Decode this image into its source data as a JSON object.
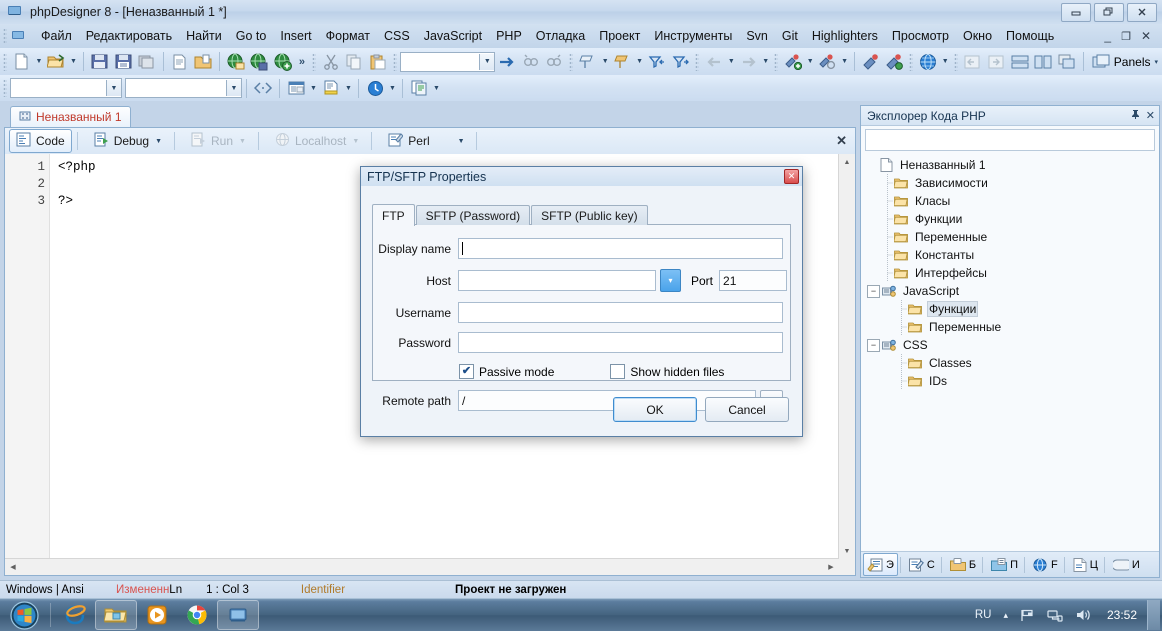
{
  "window": {
    "title": "phpDesigner 8 - [Неназванный 1 *]",
    "icon": "app-icon",
    "minimize": "–",
    "maximize": "❐",
    "close": "✕"
  },
  "menubar": {
    "items": [
      {
        "label": "Файл"
      },
      {
        "label": "Редактировать"
      },
      {
        "label": "Найти"
      },
      {
        "label": "Go to"
      },
      {
        "label": "Insert"
      },
      {
        "label": "Формат"
      },
      {
        "label": "CSS"
      },
      {
        "label": "JavaScript"
      },
      {
        "label": "PHP"
      },
      {
        "label": "Отладка"
      },
      {
        "label": "Проект"
      },
      {
        "label": "Инструменты"
      },
      {
        "label": "Svn"
      },
      {
        "label": "Git"
      },
      {
        "label": "Highlighters"
      },
      {
        "label": "Просмотр"
      },
      {
        "label": "Окно"
      },
      {
        "label": "Помощь"
      }
    ],
    "mdi_minimize": "_",
    "mdi_restore": "❐",
    "mdi_close": "✕"
  },
  "toolbar1": {
    "overflow_label": "»",
    "search_combo_value": "",
    "panels_label": "Panels",
    "panels_arrow": "▾"
  },
  "toolbar2": {
    "combo1_value": "",
    "combo2_value": ""
  },
  "editor": {
    "tab_label": "Неназванный 1",
    "buttons": [
      {
        "label": "Code",
        "state": "active",
        "has_arrow": false
      },
      {
        "label": "Debug",
        "state": "enabled",
        "has_arrow": true
      },
      {
        "label": "Run",
        "state": "disabled",
        "has_arrow": true
      },
      {
        "label": "Localhost",
        "state": "disabled",
        "has_arrow": true
      },
      {
        "label": "Perl",
        "state": "enabled",
        "has_arrow": true
      }
    ],
    "close_label": "✕",
    "code_lines": [
      {
        "num": "1",
        "text": "<?php"
      },
      {
        "num": "2",
        "text": ""
      },
      {
        "num": "3",
        "text": "?>"
      }
    ]
  },
  "right_panel": {
    "title": "Эксплорер Кода PHP",
    "pin_icon": "pin-icon",
    "close_icon": "✕",
    "search_value": "",
    "tree": [
      {
        "label": "Неназванный 1",
        "depth": 0,
        "icon": "file-icon",
        "expander": "",
        "selected": false
      },
      {
        "label": "Зависимости",
        "depth": 1,
        "icon": "folder-icon",
        "expander": "",
        "selected": false
      },
      {
        "label": "Класы",
        "depth": 1,
        "icon": "folder-icon",
        "expander": "",
        "selected": false
      },
      {
        "label": "Функции",
        "depth": 1,
        "icon": "folder-icon",
        "expander": "",
        "selected": false
      },
      {
        "label": "Переменные",
        "depth": 1,
        "icon": "folder-icon",
        "expander": "",
        "selected": false
      },
      {
        "label": "Константы",
        "depth": 1,
        "icon": "folder-icon",
        "expander": "",
        "selected": false
      },
      {
        "label": "Интерфейсы",
        "depth": 1,
        "icon": "folder-icon",
        "expander": "",
        "selected": false
      },
      {
        "label": "JavaScript",
        "depth": 0,
        "icon": "script-icon",
        "expander": "−",
        "selected": false
      },
      {
        "label": "Функции",
        "depth": 2,
        "icon": "folder-icon",
        "expander": "",
        "selected": true
      },
      {
        "label": "Переменные",
        "depth": 2,
        "icon": "folder-icon",
        "expander": "",
        "selected": false
      },
      {
        "label": "CSS",
        "depth": 0,
        "icon": "script-icon",
        "expander": "−",
        "selected": false
      },
      {
        "label": "Classes",
        "depth": 2,
        "icon": "folder-icon",
        "expander": "",
        "selected": false
      },
      {
        "label": "IDs",
        "depth": 2,
        "icon": "folder-icon",
        "expander": "",
        "selected": false
      }
    ],
    "tabs": [
      {
        "label": "Э",
        "icon": "explorer-icon",
        "active": true
      },
      {
        "label": "С",
        "icon": "snippets-icon",
        "active": false
      },
      {
        "label": "Б",
        "icon": "library-icon",
        "active": false
      },
      {
        "label": "П",
        "icon": "projects-icon",
        "active": false
      },
      {
        "label": "F",
        "icon": "ftp-icon",
        "active": false
      },
      {
        "label": "Ц",
        "icon": "todo-icon",
        "active": false
      },
      {
        "label": "И",
        "icon": "messages-icon",
        "active": false
      }
    ]
  },
  "statusbar": {
    "encoding": "Windows | Ansi",
    "modified": "Измененн",
    "ln_label": "Ln",
    "position": "1 : Col   3",
    "token": "Identifier",
    "project": "Проект не загружен"
  },
  "dialog": {
    "title": "FTP/SFTP Properties",
    "close_label": "✕",
    "tabs": [
      {
        "label": "FTP",
        "active": true
      },
      {
        "label": "SFTP (Password)",
        "active": false
      },
      {
        "label": "SFTP (Public key)",
        "active": false
      }
    ],
    "fields": {
      "display_name_label": "Display name",
      "display_name_value": "",
      "host_label": "Host",
      "host_value": "",
      "host_dropdown_arrow": "▾",
      "port_label": "Port",
      "port_value": "21",
      "username_label": "Username",
      "username_value": "",
      "password_label": "Password",
      "password_value": "",
      "remote_path_label": "Remote path",
      "remote_path_value": "/",
      "browse_label": "..."
    },
    "checkboxes": [
      {
        "label": "Passive mode",
        "checked": true,
        "mark": "✔"
      },
      {
        "label": "Show hidden files",
        "checked": false,
        "mark": ""
      }
    ],
    "ok_label": "OK",
    "cancel_label": "Cancel"
  },
  "taskbar": {
    "start_icon": "windows-start-icon",
    "items": [
      {
        "icon": "internet-explorer-icon",
        "open": false
      },
      {
        "icon": "file-explorer-icon",
        "open": true
      },
      {
        "icon": "media-player-icon",
        "open": false
      },
      {
        "icon": "chrome-icon",
        "open": false
      },
      {
        "icon": "phpdesigner-icon",
        "open": true
      }
    ],
    "language": "RU",
    "tray_expand": "▴",
    "tray_icons": [
      "flag-icon",
      "network-icon",
      "volume-icon"
    ],
    "clock": "23:52"
  },
  "colors": {
    "accent": "#4aa3ea",
    "title_text": "#15324f",
    "tab_text_red": "#c0392b",
    "status_modified": "#d9534f",
    "status_token": "#b07a2a"
  }
}
